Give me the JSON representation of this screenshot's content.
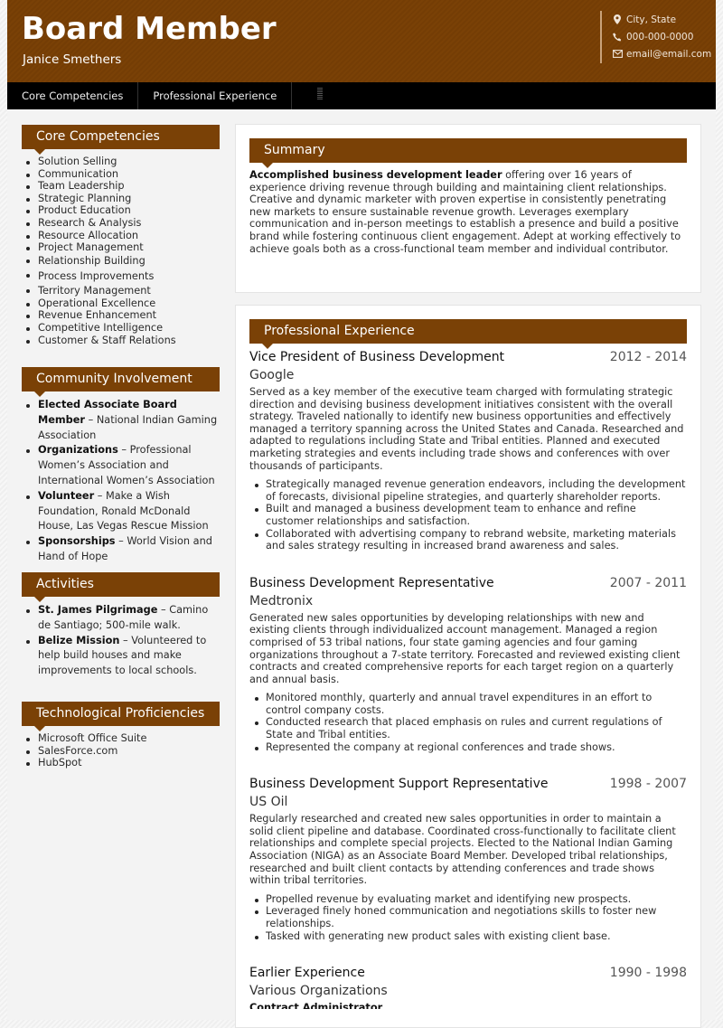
{
  "header": {
    "title": "Board Member",
    "name": "Janice Smethers",
    "contact": {
      "location": "City, State",
      "phone": "000-000-0000",
      "email": "email@email.com"
    }
  },
  "nav": {
    "tabs": [
      {
        "label": "Core Competencies"
      },
      {
        "label": "Professional Experience"
      }
    ]
  },
  "colors": {
    "accent": "#7a4106",
    "nav_bg": "#000000"
  },
  "sidebar": {
    "core": {
      "title": "Core Competencies",
      "items": [
        "Solution Selling",
        "Communication",
        "Team Leadership",
        "Strategic Planning",
        "Product Education",
        "Research & Analysis",
        "Resource Allocation",
        "Project Management",
        "Relationship Building",
        "Process Improvements",
        "Territory Management",
        "Operational Excellence",
        "Revenue Enhancement",
        "Competitive Intelligence",
        "Customer & Staff Relations"
      ]
    },
    "community": {
      "title": "Community Involvement",
      "items": [
        {
          "bold": "Elected Associate Board Member",
          "text": " – National Indian Gaming Association"
        },
        {
          "bold": "Organizations",
          "text": " – Professional Women’s Association and International Women’s Association"
        },
        {
          "bold": "Volunteer",
          "text": " – Make a Wish Foundation, Ronald McDonald House, Las Vegas Rescue Mission"
        },
        {
          "bold": "Sponsorships",
          "text": " – World Vision and Hand of Hope"
        }
      ]
    },
    "activities": {
      "title": "Activities",
      "items": [
        {
          "bold": "St. James Pilgrimage",
          "text": " – Camino de Santiago; 500-mile walk."
        },
        {
          "bold": "Belize Mission",
          "text": " – Volunteered to help build houses and make improvements to local schools."
        }
      ]
    },
    "tech": {
      "title": "Technological Proficiencies",
      "items": [
        "Microsoft Office Suite",
        "SalesForce.com",
        "HubSpot"
      ]
    }
  },
  "summary": {
    "title": "Summary",
    "lead": "Accomplished business development leader",
    "text": " offering over 16 years of experience driving revenue through building and maintaining client relationships. Creative and dynamic marketer with proven expertise in consistently penetrating new markets to ensure sustainable revenue growth. Leverages exemplary communication and in-person meetings to establish a presence and build a positive brand while fostering continuous client engagement. Adept at working effectively to achieve goals both as a cross-functional team member and individual contributor."
  },
  "experience": {
    "title": "Professional Experience",
    "jobs": [
      {
        "title": "Vice President of Business Development",
        "dates": "2012 - 2014",
        "company": "Google",
        "description": "Served as a key member of the executive team charged with formulating strategic direction and devising business development initiatives consistent with the overall strategy. Traveled nationally to identify new business opportunities and effectively managed a territory spanning across the United States and Canada. Researched and adapted to regulations including State and Tribal entities. Planned and executed marketing strategies and events including trade shows and conferences with over thousands of participants.",
        "bullets": [
          "Strategically managed revenue generation endeavors, including the development of forecasts, divisional pipeline strategies, and quarterly shareholder reports.",
          "Built and managed a business development team to enhance and refine customer relationships and satisfaction.",
          "Collaborated with advertising company to rebrand website, marketing materials and sales strategy resulting in increased brand awareness and sales."
        ]
      },
      {
        "title": "Business Development Representative",
        "dates": "2007 - 2011",
        "company": "Medtronix",
        "description": "Generated new sales opportunities by developing relationships with new and existing clients through individualized account management. Managed a region comprised of 53 tribal nations, four state gaming agencies and four gaming organizations throughout a 7-state territory. Forecasted and reviewed existing client contracts and created comprehensive reports for each target region on a quarterly and annual basis.",
        "bullets": [
          "Monitored monthly, quarterly and annual travel expenditures in an effort to control company costs.",
          "Conducted research that placed emphasis on rules and current regulations of State and Tribal entities.",
          "Represented the company at regional conferences and trade shows."
        ]
      },
      {
        "title": "Business Development Support Representative",
        "dates": "1998 - 2007",
        "company": "US Oil",
        "description": "Regularly researched and created new sales opportunities in order to maintain a solid client pipeline and database. Coordinated cross-functionally to facilitate client relationships and complete special projects. Elected to the National Indian Gaming Association (NIGA) as an Associate Board Member. Developed tribal relationships, researched and built client contacts by attending conferences and trade shows within tribal territories.",
        "bullets": [
          "Propelled revenue by evaluating market and identifying new prospects.",
          "Leveraged finely honed communication and negotiations skills to foster new relationships.",
          "Tasked with generating new product sales with existing client base."
        ]
      },
      {
        "title": "Earlier Experience",
        "dates": "1990 - 1998",
        "company": "Various Organizations",
        "subtitle": "Contract Administrator"
      }
    ]
  }
}
